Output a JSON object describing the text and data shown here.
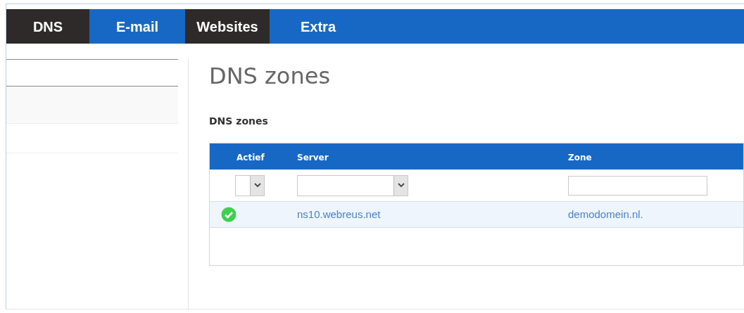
{
  "tabs": [
    {
      "label": "DNS",
      "selected": true
    },
    {
      "label": "E-mail",
      "selected": false
    },
    {
      "label": "Websites",
      "selected": true
    },
    {
      "label": "Extra",
      "selected": false
    }
  ],
  "sidebar": {
    "items": [
      {
        "selected": false
      },
      {
        "selected": true
      },
      {
        "selected": false
      }
    ]
  },
  "page_title": "DNS zones",
  "section_title": "DNS zones",
  "table": {
    "columns": [
      "Actief",
      "Server",
      "Zone"
    ],
    "filters": [
      {
        "kind": "select"
      },
      {
        "kind": "select"
      },
      {
        "kind": "text"
      }
    ],
    "rows": [
      {
        "active": true,
        "server": "ns10.webreus.net",
        "zone": "demodomein.nl."
      }
    ]
  }
}
